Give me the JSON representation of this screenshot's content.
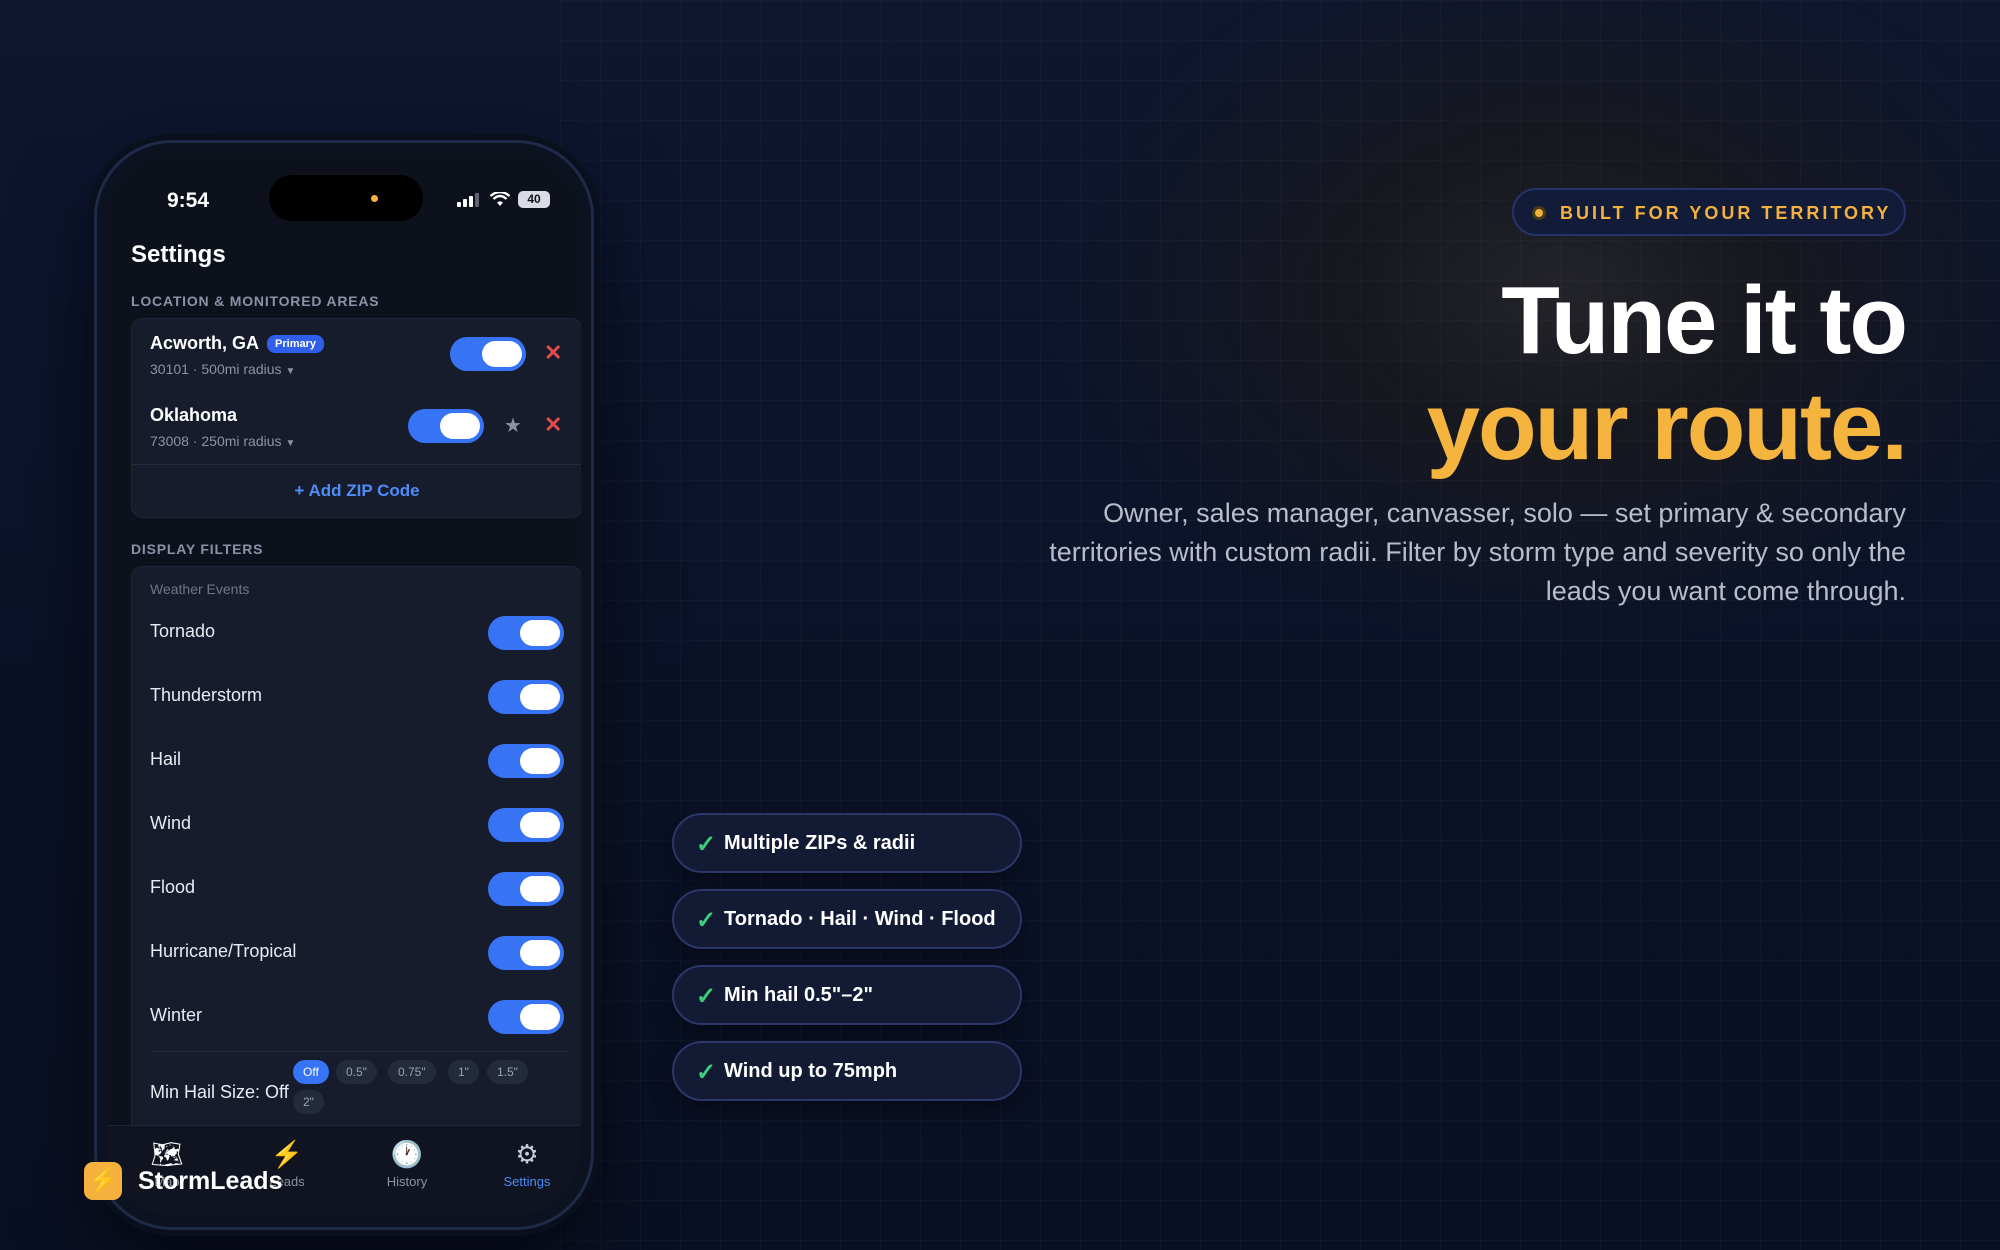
{
  "colors": {
    "accent": "#f4b43e",
    "toggle_on": "#3674f5",
    "link": "#4e8cf7",
    "danger": "#e24a4a",
    "check": "#3ccf7a"
  },
  "phone": {
    "status": {
      "time": "9:54",
      "battery": "40"
    },
    "title": "Settings",
    "locations": {
      "section_label": "LOCATION & MONITORED AREAS",
      "items": [
        {
          "name": "Acworth, GA",
          "badge": "Primary",
          "detail": "30101 · 500mi radius",
          "enabled": true
        },
        {
          "name": "Oklahoma",
          "detail": "73008 · 250mi radius",
          "enabled": true
        }
      ],
      "add_label": "+ Add ZIP Code"
    },
    "filters": {
      "section_label": "DISPLAY FILTERS",
      "sub_label": "Weather Events",
      "items": [
        {
          "label": "Tornado",
          "enabled": true
        },
        {
          "label": "Thunderstorm",
          "enabled": true
        },
        {
          "label": "Hail",
          "enabled": true
        },
        {
          "label": "Wind",
          "enabled": true
        },
        {
          "label": "Flood",
          "enabled": true
        },
        {
          "label": "Hurricane/Tropical",
          "enabled": true
        },
        {
          "label": "Winter",
          "enabled": true
        }
      ],
      "hail_label": "Min Hail Size: Off",
      "hail_options": [
        "Off",
        "0.5\"",
        "0.75\"",
        "1\"",
        "1.5\"",
        "2\""
      ],
      "hail_selected": "Off"
    },
    "tabs": [
      {
        "label": "Map",
        "icon": "map-icon"
      },
      {
        "label": "Leads",
        "icon": "bolt-icon"
      },
      {
        "label": "History",
        "icon": "clock-icon"
      },
      {
        "label": "Settings",
        "icon": "gear-icon",
        "active": true
      }
    ]
  },
  "brand": {
    "name": "StormLeads",
    "icon": "bolt-icon"
  },
  "hero": {
    "pill": "BUILT FOR YOUR TERRITORY",
    "headline_line1": "Tune it to",
    "headline_line2": "your route.",
    "subcopy": "Owner, sales manager, canvasser, solo — set primary & secondary territories with custom radii. Filter by storm type and severity so only the leads you want come through."
  },
  "features": [
    "Multiple ZIPs & radii",
    "Tornado · Hail · Wind · Flood",
    "Min hail 0.5\"–2\"",
    "Wind up to 75mph"
  ]
}
